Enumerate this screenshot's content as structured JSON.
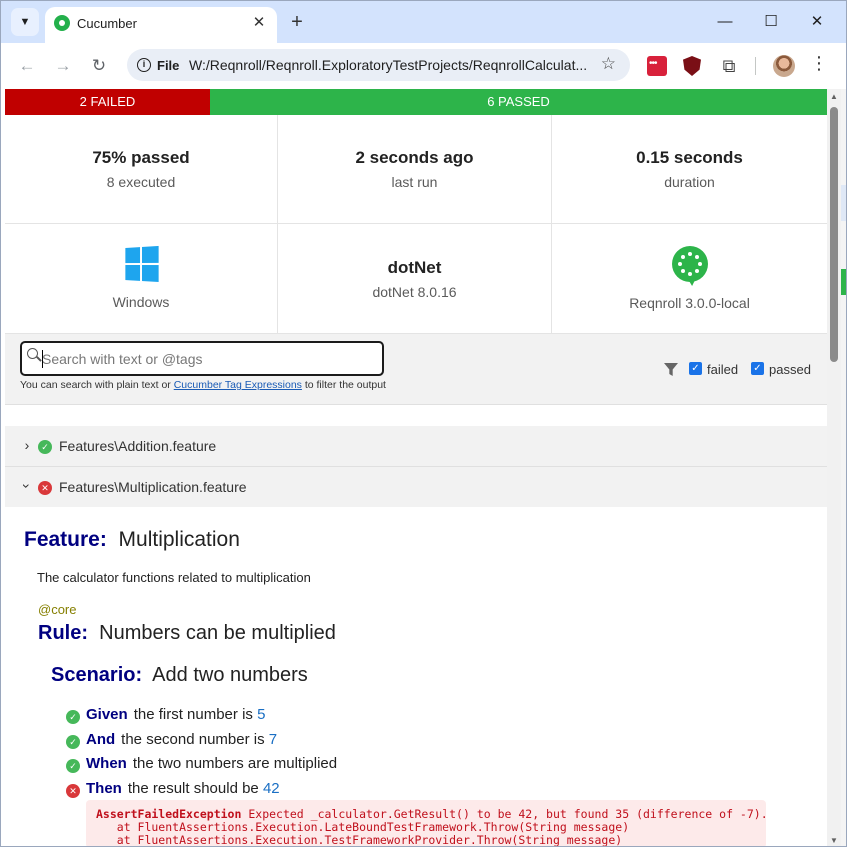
{
  "browser": {
    "tab_title": "Cucumber",
    "address": {
      "site_label": "File",
      "url": "W:/Reqnroll/Reqnroll.ExploratoryTestProjects/ReqnrollCalculat..."
    },
    "window_controls": {
      "minimize": "—",
      "maximize": "☐",
      "close": "✕"
    }
  },
  "report": {
    "status_bar": {
      "failed": "2 FAILED",
      "passed": "6 PASSED"
    },
    "stats": {
      "passed_pct": "75% passed",
      "executed": "8 executed",
      "last_run": "2 seconds ago",
      "last_run_label": "last run",
      "duration": "0.15 seconds",
      "duration_label": "duration",
      "os": "Windows",
      "runtime": "dotNet",
      "runtime_version": "dotNet 8.0.16",
      "tool": "Reqnroll 3.0.0-local"
    },
    "search": {
      "placeholder": "Search with text or @tags",
      "help_prefix": "You can search with plain text or",
      "help_link": "Cucumber Tag Expressions",
      "help_suffix": "to filter the output",
      "filter_failed": "failed",
      "filter_passed": "passed"
    },
    "features": [
      {
        "label": "Features\\Addition.feature",
        "status": "passed",
        "expanded": false
      },
      {
        "label": "Features\\Multiplication.feature",
        "status": "failed",
        "expanded": true
      }
    ],
    "feature": {
      "keyword": "Feature:",
      "name": "Multiplication",
      "description": "The calculator functions related to multiplication",
      "tag": "@core",
      "rule_keyword": "Rule:",
      "rule_name": "Numbers can be multiplied",
      "scenario_keyword": "Scenario:",
      "scenario_name": "Add two numbers",
      "steps": [
        {
          "status": "passed",
          "keyword": "Given",
          "text": "the first number is",
          "param": "5"
        },
        {
          "status": "passed",
          "keyword": "And",
          "text": "the second number is",
          "param": "7"
        },
        {
          "status": "passed",
          "keyword": "When",
          "text": "the two numbers are multiplied",
          "param": ""
        },
        {
          "status": "failed",
          "keyword": "Then",
          "text": "the result should be",
          "param": "42"
        }
      ],
      "error": {
        "exception": "AssertFailedException",
        "message": "Expected _calculator.GetResult() to be 42, but found 35 (difference of -7).",
        "trace_1": "   at FluentAssertions.Execution.LateBoundTestFramework.Throw(String message)",
        "trace_2": "   at FluentAssertions.Execution.TestFrameworkProvider.Throw(String message)"
      }
    }
  },
  "colors": {
    "failed": "#c00000",
    "passed": "#2db44a",
    "keyword": "#000080",
    "tag": "#857f00",
    "param": "#1a6fc4",
    "error_text": "#c0101c"
  }
}
